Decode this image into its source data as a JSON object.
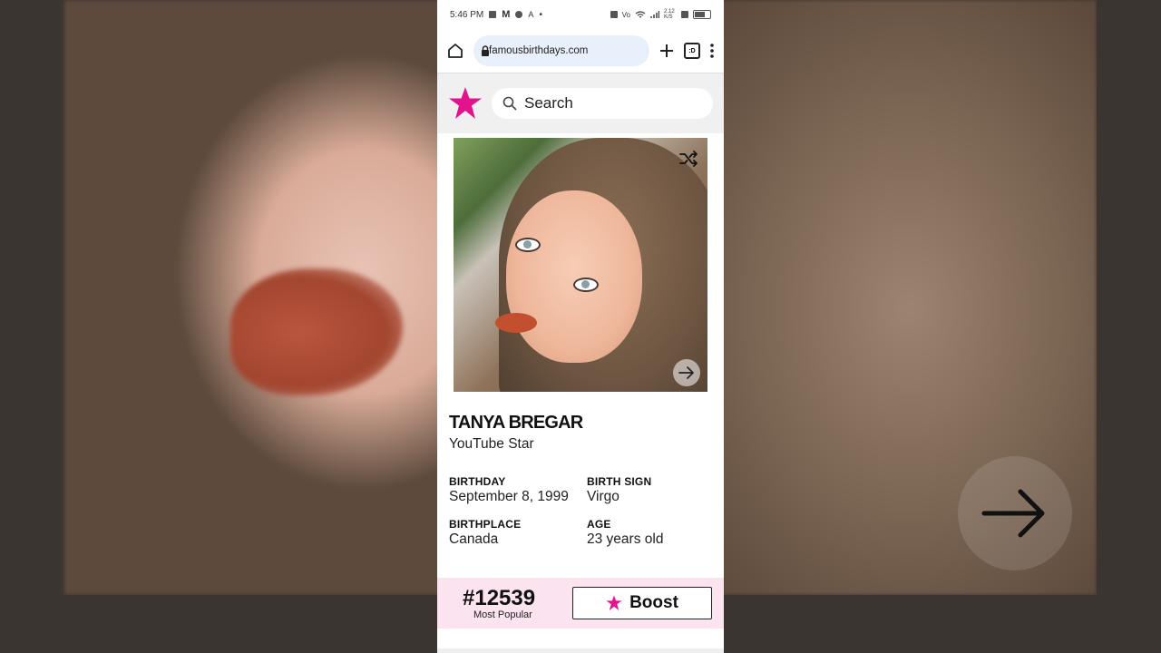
{
  "status_bar": {
    "time": "5:46 PM",
    "net_speed": "2.12 K/S"
  },
  "browser": {
    "url": "famousbirthdays.com",
    "tab_count": ":D"
  },
  "site": {
    "search_placeholder": "Search",
    "brand_color": "#e4128d"
  },
  "profile": {
    "name": "TANYA BREGAR",
    "profession": "YouTube Star",
    "facts": [
      {
        "label": "BIRTHDAY",
        "value": "September 8, 1999"
      },
      {
        "label": "BIRTH SIGN",
        "value": "Virgo"
      },
      {
        "label": "BIRTHPLACE",
        "value": "Canada"
      },
      {
        "label": "AGE",
        "value": "23 years old"
      }
    ]
  },
  "popularity": {
    "rank": "#12539",
    "rank_label": "Most Popular",
    "boost_label": "Boost"
  }
}
